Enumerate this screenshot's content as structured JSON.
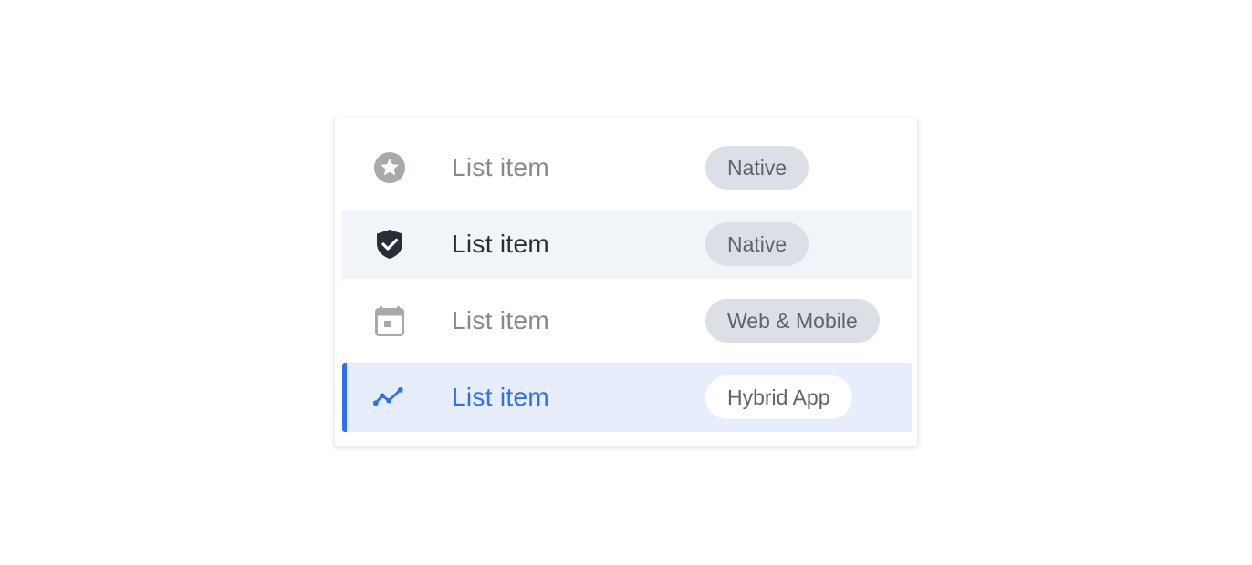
{
  "list": {
    "items": [
      {
        "label": "List item",
        "tag": "Native",
        "icon": "star-icon",
        "state": "default"
      },
      {
        "label": "List item",
        "tag": "Native",
        "icon": "shield-check-icon",
        "state": "hover"
      },
      {
        "label": "List item",
        "tag": "Web & Mobile",
        "icon": "calendar-icon",
        "state": "default"
      },
      {
        "label": "List item",
        "tag": "Hybrid App",
        "icon": "trend-line-icon",
        "state": "active"
      }
    ]
  },
  "colors": {
    "accent": "#2f6ff0",
    "active_bg": "#e6eefd",
    "hover_bg": "#f1f4f9",
    "tag_bg": "#dcdfe6",
    "muted_text": "#86888c",
    "dark_text": "#2a2d33"
  }
}
